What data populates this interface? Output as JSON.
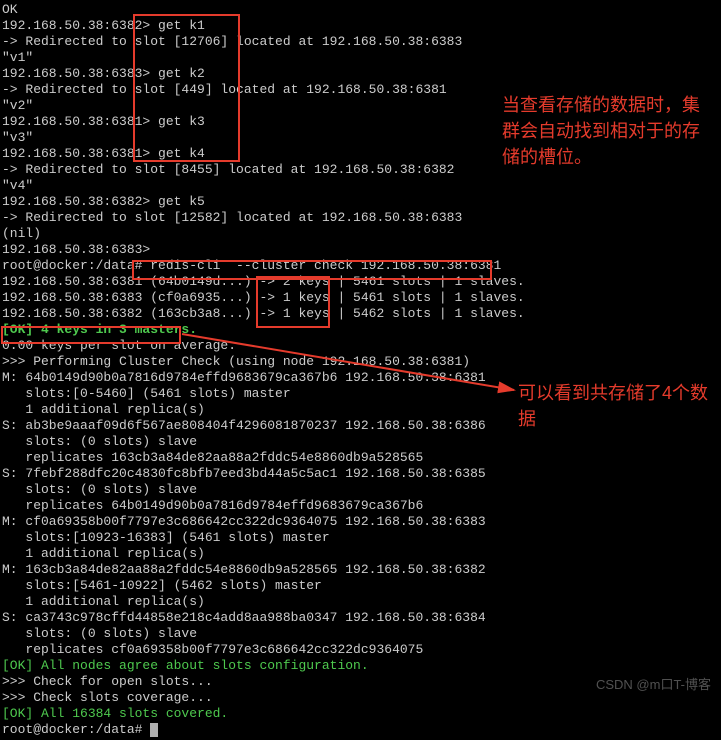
{
  "lines": [
    {
      "cls": "white",
      "text": "OK"
    },
    {
      "cls": "white",
      "text": "192.168.50.38:6382> get k1"
    },
    {
      "cls": "white",
      "text": "-> Redirected to slot [12706] located at 192.168.50.38:6383"
    },
    {
      "cls": "white",
      "text": "\"v1\""
    },
    {
      "cls": "white",
      "text": "192.168.50.38:6383> get k2"
    },
    {
      "cls": "white",
      "text": "-> Redirected to slot [449] located at 192.168.50.38:6381"
    },
    {
      "cls": "white",
      "text": "\"v2\""
    },
    {
      "cls": "white",
      "text": "192.168.50.38:6381> get k3"
    },
    {
      "cls": "white",
      "text": "\"v3\""
    },
    {
      "cls": "white",
      "text": "192.168.50.38:6381> get k4"
    },
    {
      "cls": "white",
      "text": "-> Redirected to slot [8455] located at 192.168.50.38:6382"
    },
    {
      "cls": "white",
      "text": "\"v4\""
    },
    {
      "cls": "white",
      "text": "192.168.50.38:6382> get k5"
    },
    {
      "cls": "white",
      "text": "-> Redirected to slot [12582] located at 192.168.50.38:6383"
    },
    {
      "cls": "white",
      "text": "(nil)"
    },
    {
      "cls": "white",
      "text": "192.168.50.38:6383>"
    },
    {
      "cls": "white",
      "text": "root@docker:/data# redis-cli  --cluster check 192.168.50.38:6381"
    },
    {
      "cls": "white",
      "text": "192.168.50.38:6381 (64b0149d...) -> 2 keys | 5461 slots | 1 slaves."
    },
    {
      "cls": "white",
      "text": "192.168.50.38:6383 (cf0a6935...) -> 1 keys | 5461 slots | 1 slaves."
    },
    {
      "cls": "white",
      "text": "192.168.50.38:6382 (163cb3a8...) -> 1 keys | 5462 slots | 1 slaves."
    },
    {
      "cls": "greenbold",
      "text": "[OK] 4 keys in 3 masters."
    },
    {
      "cls": "white",
      "text": "0.00 keys per slot on average."
    },
    {
      "cls": "white",
      "text": ">>> Performing Cluster Check (using node 192.168.50.38:6381)"
    },
    {
      "cls": "white",
      "text": "M: 64b0149d90b0a7816d9784effd9683679ca367b6 192.168.50.38:6381"
    },
    {
      "cls": "white",
      "text": "   slots:[0-5460] (5461 slots) master"
    },
    {
      "cls": "white",
      "text": "   1 additional replica(s)"
    },
    {
      "cls": "white",
      "text": "S: ab3be9aaaf09d6f567ae808404f4296081870237 192.168.50.38:6386"
    },
    {
      "cls": "white",
      "text": "   slots: (0 slots) slave"
    },
    {
      "cls": "white",
      "text": "   replicates 163cb3a84de82aa88a2fddc54e8860db9a528565"
    },
    {
      "cls": "white",
      "text": "S: 7febf288dfc20c4830fc8bfb7eed3bd44a5c5ac1 192.168.50.38:6385"
    },
    {
      "cls": "white",
      "text": "   slots: (0 slots) slave"
    },
    {
      "cls": "white",
      "text": "   replicates 64b0149d90b0a7816d9784effd9683679ca367b6"
    },
    {
      "cls": "white",
      "text": "M: cf0a69358b00f7797e3c686642cc322dc9364075 192.168.50.38:6383"
    },
    {
      "cls": "white",
      "text": "   slots:[10923-16383] (5461 slots) master"
    },
    {
      "cls": "white",
      "text": "   1 additional replica(s)"
    },
    {
      "cls": "white",
      "text": "M: 163cb3a84de82aa88a2fddc54e8860db9a528565 192.168.50.38:6382"
    },
    {
      "cls": "white",
      "text": "   slots:[5461-10922] (5462 slots) master"
    },
    {
      "cls": "white",
      "text": "   1 additional replica(s)"
    },
    {
      "cls": "white",
      "text": "S: ca3743c978cffd44858e218c4add8aa988ba0347 192.168.50.38:6384"
    },
    {
      "cls": "white",
      "text": "   slots: (0 slots) slave"
    },
    {
      "cls": "white",
      "text": "   replicates cf0a69358b00f7797e3c686642cc322dc9364075"
    },
    {
      "cls": "green",
      "text": "[OK] All nodes agree about slots configuration."
    },
    {
      "cls": "white",
      "text": ">>> Check for open slots..."
    },
    {
      "cls": "white",
      "text": ">>> Check slots coverage..."
    },
    {
      "cls": "green",
      "text": "[OK] All 16384 slots covered."
    },
    {
      "cls": "white",
      "text": "root@docker:/data# ",
      "cursor": true
    }
  ],
  "annotations": {
    "a1": "当查看存储的数据时，集群会自动找到相对于的存储的槽位。",
    "a2": "可以看到共存储了4个数据"
  },
  "watermark": "CSDN @m口T-博客"
}
